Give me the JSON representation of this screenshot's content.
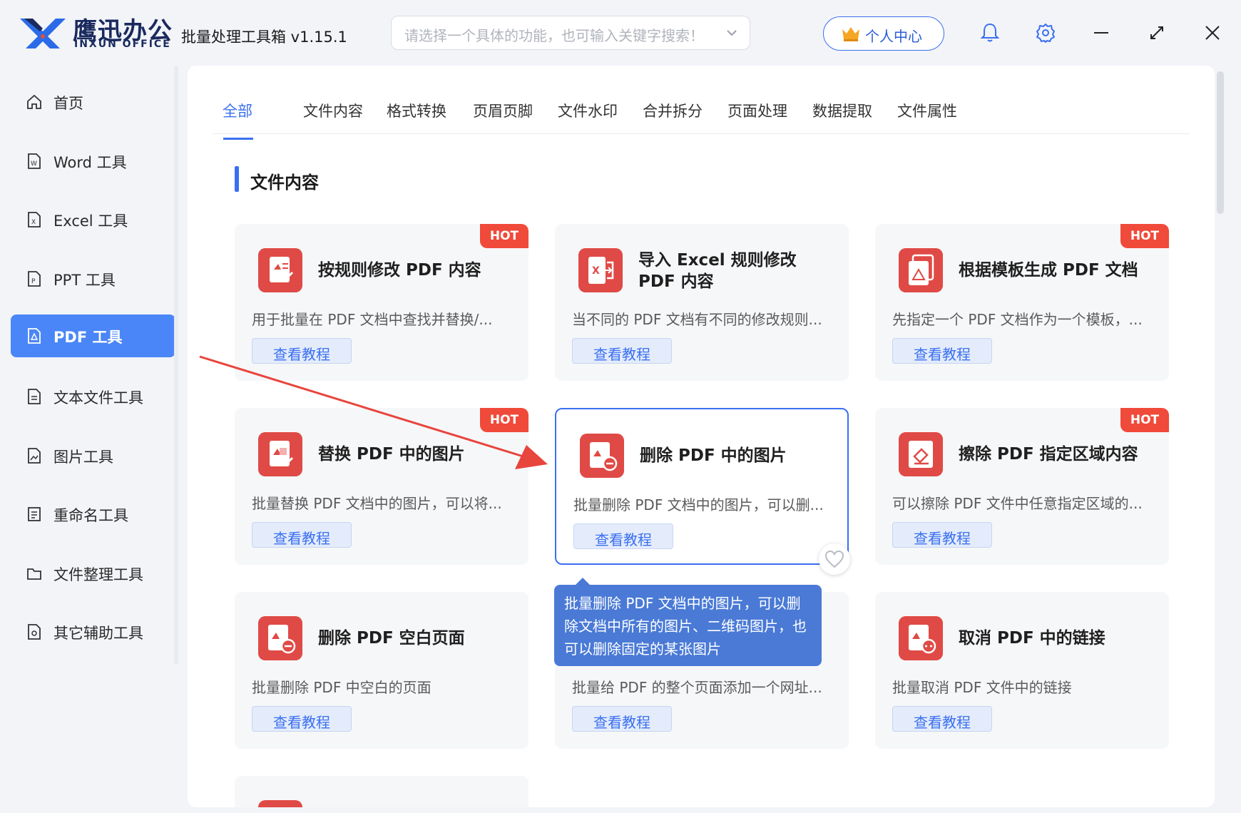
{
  "app": {
    "logo_cn": "鹰迅办公",
    "logo_en": "INXUN OFFICE",
    "title": "批量处理工具箱 v1.15.1"
  },
  "search": {
    "placeholder": "请选择一个具体的功能，也可输入关键字搜索！"
  },
  "user": {
    "label": "个人中心"
  },
  "sidebar": {
    "items": [
      {
        "label": "首页",
        "icon": "home-icon"
      },
      {
        "label": "Word 工具",
        "icon": "word-doc-icon"
      },
      {
        "label": "Excel 工具",
        "icon": "excel-doc-icon"
      },
      {
        "label": "PPT 工具",
        "icon": "ppt-doc-icon"
      },
      {
        "label": "PDF 工具",
        "icon": "pdf-doc-icon",
        "active": true
      },
      {
        "label": "文本文件工具",
        "icon": "text-file-icon"
      },
      {
        "label": "图片工具",
        "icon": "image-file-icon"
      },
      {
        "label": "重命名工具",
        "icon": "rename-icon"
      },
      {
        "label": "文件整理工具",
        "icon": "folder-icon"
      },
      {
        "label": "其它辅助工具",
        "icon": "misc-tools-icon"
      }
    ]
  },
  "tabs": [
    "全部",
    "文件内容",
    "格式转换",
    "页眉页脚",
    "文件水印",
    "合并拆分",
    "页面处理",
    "数据提取",
    "文件属性"
  ],
  "section": {
    "title": "文件内容"
  },
  "cards": [
    {
      "title": "按规则修改 PDF 内容",
      "desc": "用于批量在 PDF 文档中查找并替换/...",
      "button": "查看教程",
      "hot": "HOT"
    },
    {
      "title": "导入 Excel 规则修改 PDF 内容",
      "desc": "当不同的 PDF 文档有不同的修改规则...",
      "button": "查看教程"
    },
    {
      "title": "根据模板生成 PDF 文档",
      "desc": "先指定一个 PDF 文档作为一个模板，...",
      "button": "查看教程",
      "hot": "HOT"
    },
    {
      "title": "替换 PDF 中的图片",
      "desc": "批量替换 PDF 文档中的图片，可以将...",
      "button": "查看教程",
      "hot": "HOT"
    },
    {
      "title": "删除 PDF 中的图片",
      "desc": "批量删除 PDF 文档中的图片，可以删...",
      "button": "查看教程"
    },
    {
      "title": "擦除 PDF 指定区域内容",
      "desc": "可以擦除 PDF 文件中任意指定区域的...",
      "button": "查看教程",
      "hot": "HOT"
    },
    {
      "title": "删除 PDF 空白页面",
      "desc": "批量删除 PDF 中空白的页面",
      "button": "查看教程"
    },
    {
      "title": "",
      "desc": "批量给 PDF 的整个页面添加一个网址...",
      "button": "查看教程"
    },
    {
      "title": "取消 PDF 中的链接",
      "desc": "批量取消 PDF 文件中的链接",
      "button": "查看教程"
    }
  ],
  "tooltip": {
    "text": "批量删除 PDF 文档中的图片，可以删除文档中所有的图片、二维码图片，也可以删除固定的某张图片"
  },
  "colors": {
    "accent": "#3a6ff0",
    "sidebar_active": "#4a86f7",
    "hot": "#f04a3a",
    "pdf_icon": "#e04a46",
    "annotation_arrow": "#e8453c"
  }
}
